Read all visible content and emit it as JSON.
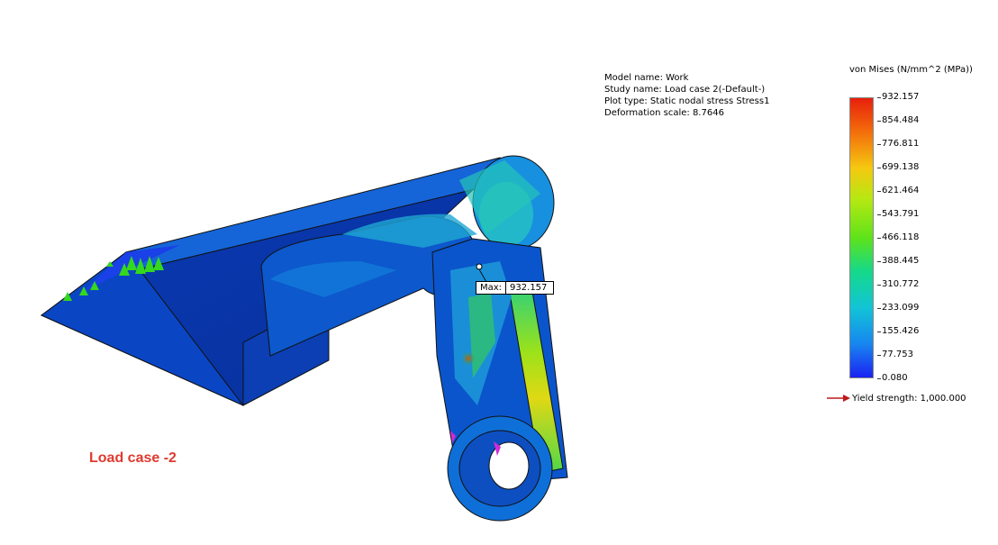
{
  "study_info": {
    "model_name": "Model name: Work",
    "study_name": "Study name: Load case 2(-Default-)",
    "plot_type": "Plot type: Static nodal stress Stress1",
    "deformation_scale": "Deformation scale: 8.7646"
  },
  "legend": {
    "title": "von Mises (N/mm^2 (MPa))",
    "values": [
      "932.157",
      "854.484",
      "776.811",
      "699.138",
      "621.464",
      "543.791",
      "466.118",
      "388.445",
      "310.772",
      "233.099",
      "155.426",
      "77.753",
      "0.080"
    ],
    "colors": {
      "max": "#e8200c",
      "mid": "#5ee31a",
      "min": "#1b22f2"
    }
  },
  "yield": {
    "label": "Yield strength: 1,000.000",
    "icon": "right-arrow-icon",
    "color": "#c0191b"
  },
  "max_probe": {
    "label": "Max:",
    "value": "932.157"
  },
  "load_case_label": "Load case -2"
}
